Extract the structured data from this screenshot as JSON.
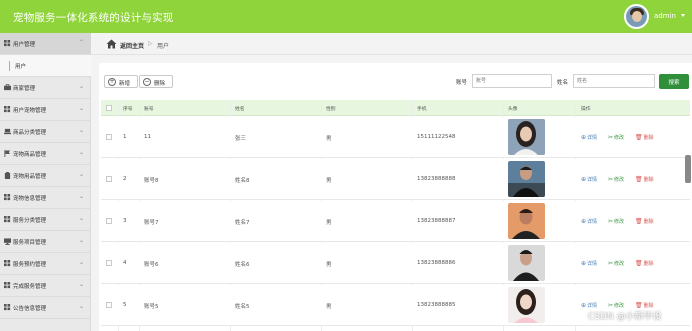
{
  "header": {
    "title": "宠物服务一体化系统的设计与实现",
    "user": "admin",
    "accent": "#8fd43a"
  },
  "sidebar": {
    "items": [
      {
        "label": "用户管理",
        "icon": "grid-icon",
        "active": true
      },
      {
        "label": "商家管理",
        "icon": "briefcase-icon"
      },
      {
        "label": "用户宠物管理",
        "icon": "grid-icon"
      },
      {
        "label": "商品分类管理",
        "icon": "laptop-icon"
      },
      {
        "label": "宠物商品管理",
        "icon": "flag-icon"
      },
      {
        "label": "宠物用品管理",
        "icon": "clipboard-icon"
      },
      {
        "label": "宠物信息管理",
        "icon": "grid-icon"
      },
      {
        "label": "服务分类管理",
        "icon": "grid-icon"
      },
      {
        "label": "服务项目管理",
        "icon": "monitor-icon"
      },
      {
        "label": "服务预约管理",
        "icon": "grid-icon"
      },
      {
        "label": "完成服务管理",
        "icon": "grid-icon"
      },
      {
        "label": "公告信息管理",
        "icon": "grid-icon"
      }
    ],
    "sub_items": [
      {
        "label": "用户"
      }
    ]
  },
  "breadcrumb": {
    "home": "返回主页",
    "separator": "▷",
    "current": "用户"
  },
  "toolbar": {
    "add_label": "新增",
    "delete_label": "删除",
    "search_account_label": "账号",
    "search_account_placeholder": "账号",
    "search_name_label": "姓名",
    "search_name_placeholder": "姓名",
    "search_button": "搜索",
    "search_button_color": "#2f8f3a"
  },
  "table": {
    "columns": [
      "序号",
      "账号",
      "姓名",
      "性别",
      "手机",
      "头像",
      "操作"
    ],
    "rows": [
      {
        "index": "1",
        "account": "11",
        "name": "张三",
        "gender": "男",
        "phone": "15111122548",
        "avatar": "woman-avatar"
      },
      {
        "index": "2",
        "account": "账号8",
        "name": "姓名8",
        "gender": "男",
        "phone": "13823888888",
        "avatar": "man-avatar"
      },
      {
        "index": "3",
        "account": "账号7",
        "name": "姓名7",
        "gender": "男",
        "phone": "13823888887",
        "avatar": "man-avatar"
      },
      {
        "index": "4",
        "account": "账号6",
        "name": "姓名6",
        "gender": "男",
        "phone": "13823888886",
        "avatar": "man-avatar"
      },
      {
        "index": "5",
        "account": "账号5",
        "name": "姓名5",
        "gender": "男",
        "phone": "13823888885",
        "avatar": "woman-avatar"
      }
    ],
    "actions": {
      "detail": "详情",
      "edit": "修改",
      "delete": "删除"
    }
  },
  "watermark": "CSDN @小新毕设"
}
